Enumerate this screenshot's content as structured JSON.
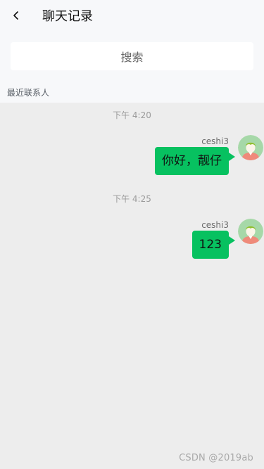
{
  "header": {
    "title": "聊天记录",
    "back_icon": "chevron-left-icon"
  },
  "search": {
    "label": "搜索"
  },
  "section": {
    "label": "最近联系人"
  },
  "messages": [
    {
      "time": "下午 4:20",
      "sender": "ceshi3",
      "text": "你好，靓仔",
      "avatar_icon": "user-avatar-icon"
    },
    {
      "time": "下午 4:25",
      "sender": "ceshi3",
      "text": "123",
      "avatar_icon": "user-avatar-icon"
    }
  ],
  "colors": {
    "bubble": "#07c160",
    "chat_bg": "#ededed",
    "top_bg": "#f7f8fa"
  },
  "watermark": "CSDN @2019ab"
}
